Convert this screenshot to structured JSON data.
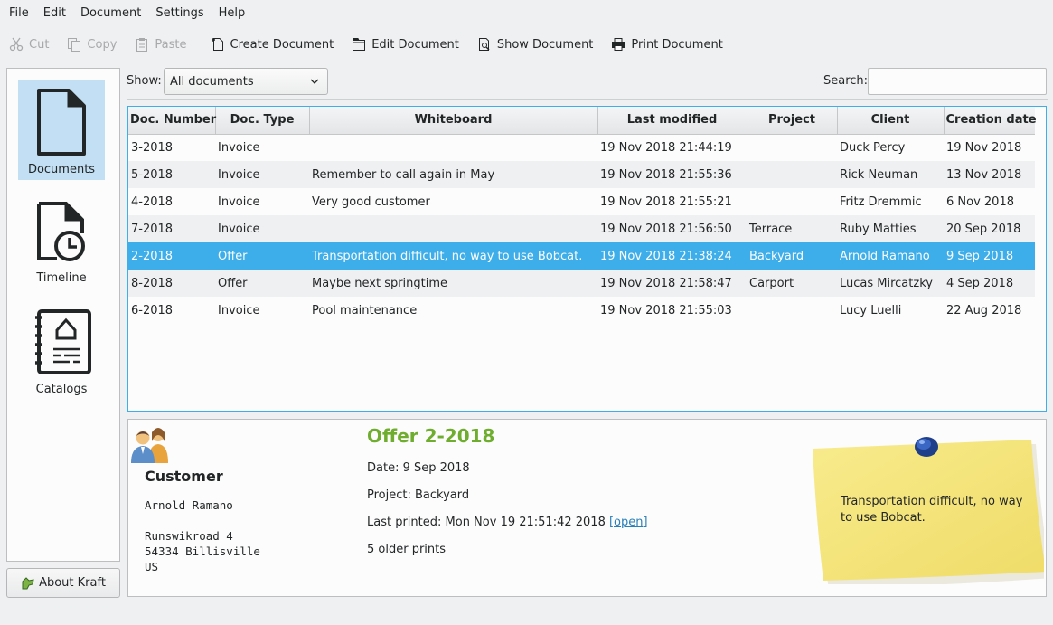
{
  "menubar": [
    "File",
    "Edit",
    "Document",
    "Settings",
    "Help"
  ],
  "toolbar": {
    "cut": "Cut",
    "copy": "Copy",
    "paste": "Paste",
    "create": "Create Document",
    "edit": "Edit Document",
    "show": "Show Document",
    "print": "Print Document"
  },
  "sidebar": {
    "documents": "Documents",
    "timeline": "Timeline",
    "catalogs": "Catalogs",
    "about": "About Kraft"
  },
  "filter": {
    "show_label": "Show:",
    "show_value": "All documents",
    "search_label": "Search:",
    "search_value": ""
  },
  "table": {
    "columns": [
      "Doc. Number",
      "Doc. Type",
      "Whiteboard",
      "Last modified",
      "Project",
      "Client",
      "Creation date"
    ],
    "rows": [
      [
        "3-2018",
        "Invoice",
        "",
        "19 Nov 2018 21:44:19",
        "",
        "Duck Percy",
        "19 Nov 2018"
      ],
      [
        "5-2018",
        "Invoice",
        "Remember to call again in May",
        "19 Nov 2018 21:55:36",
        "",
        "Rick Neuman",
        "13 Nov 2018"
      ],
      [
        "4-2018",
        "Invoice",
        "Very good customer",
        "19 Nov 2018 21:55:21",
        "",
        "Fritz Dremmic",
        "6 Nov 2018"
      ],
      [
        "7-2018",
        "Invoice",
        "",
        "19 Nov 2018 21:56:50",
        "Terrace",
        "Ruby Matties",
        "20 Sep 2018"
      ],
      [
        "2-2018",
        "Offer",
        "Transportation difficult, no way to use Bobcat.",
        "19 Nov 2018 21:38:24",
        "Backyard",
        "Arnold Ramano",
        "9 Sep 2018"
      ],
      [
        "8-2018",
        "Offer",
        "Maybe next springtime",
        "19 Nov 2018 21:58:47",
        "Carport",
        "Lucas Mircatzky",
        "4 Sep 2018"
      ],
      [
        "6-2018",
        "Invoice",
        "Pool maintenance",
        "19 Nov 2018 21:55:03",
        "",
        "Lucy Luelli",
        "22 Aug 2018"
      ]
    ],
    "selected_row": 4
  },
  "detail": {
    "customer_title": "Customer",
    "customer_address": "Arnold Ramano\n\nRunswikroad 4\n54334 Billisville\nUS",
    "doc_title": "Offer 2-2018",
    "date": "Date: 9 Sep 2018",
    "project": "Project: Backyard",
    "last_printed": "Last printed: Mon Nov 19 21:51:42 2018 ",
    "open_link": "[open]",
    "older_prints": "5 older prints",
    "note_text": "Transportation difficult, no way to use Bobcat."
  },
  "colors": {
    "selection": "#3daee9",
    "doc_title": "#6ead2e",
    "sidebar_active": "#c3dff3",
    "note": "#f5e67e"
  }
}
